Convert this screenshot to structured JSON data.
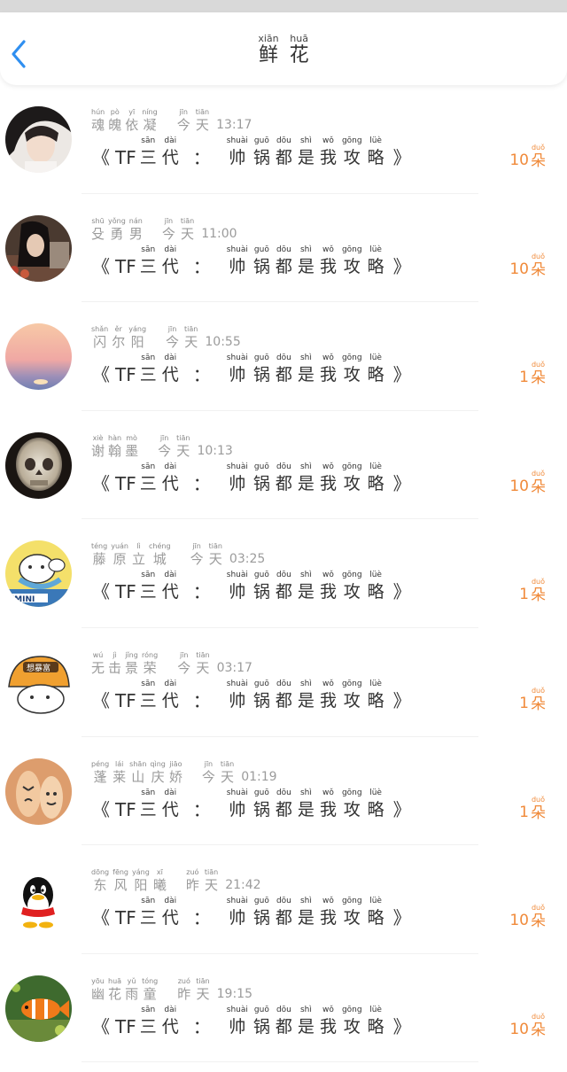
{
  "header": {
    "back_icon": "chevron-left-icon",
    "title": [
      {
        "py": "xiān",
        "hz": "鲜"
      },
      {
        "py": "huā",
        "hz": "花"
      }
    ]
  },
  "colors": {
    "accent": "#2f8ff0",
    "count": "#f08a3a"
  },
  "items": [
    {
      "name": [
        {
          "py": "hún",
          "hz": "魂"
        },
        {
          "py": "pò",
          "hz": "魄"
        },
        {
          "py": "yī",
          "hz": "依"
        },
        {
          "py": "níng",
          "hz": "凝"
        }
      ],
      "date": [
        {
          "py": "jīn",
          "hz": "今"
        },
        {
          "py": "tiān",
          "hz": "天"
        }
      ],
      "time": "13:17",
      "count": "10",
      "unit": {
        "py": "duǒ",
        "hz": "朵"
      }
    },
    {
      "name": [
        {
          "py": "shū",
          "hz": "殳"
        },
        {
          "py": "yǒng",
          "hz": "勇"
        },
        {
          "py": "nán",
          "hz": "男"
        }
      ],
      "date": [
        {
          "py": "jīn",
          "hz": "今"
        },
        {
          "py": "tiān",
          "hz": "天"
        }
      ],
      "time": "11:00",
      "count": "10",
      "unit": {
        "py": "duǒ",
        "hz": "朵"
      }
    },
    {
      "name": [
        {
          "py": "shǎn",
          "hz": "闪"
        },
        {
          "py": "ěr",
          "hz": "尔"
        },
        {
          "py": "yáng",
          "hz": "阳"
        }
      ],
      "date": [
        {
          "py": "jīn",
          "hz": "今"
        },
        {
          "py": "tiān",
          "hz": "天"
        }
      ],
      "time": "10:55",
      "count": "1",
      "unit": {
        "py": "duǒ",
        "hz": "朵"
      }
    },
    {
      "name": [
        {
          "py": "xiè",
          "hz": "谢"
        },
        {
          "py": "hàn",
          "hz": "翰"
        },
        {
          "py": "mò",
          "hz": "墨"
        }
      ],
      "date": [
        {
          "py": "jīn",
          "hz": "今"
        },
        {
          "py": "tiān",
          "hz": "天"
        }
      ],
      "time": "10:13",
      "count": "10",
      "unit": {
        "py": "duǒ",
        "hz": "朵"
      }
    },
    {
      "name": [
        {
          "py": "téng",
          "hz": "藤"
        },
        {
          "py": "yuán",
          "hz": "原"
        },
        {
          "py": "lì",
          "hz": "立"
        },
        {
          "py": "chéng",
          "hz": "城"
        }
      ],
      "date": [
        {
          "py": "jīn",
          "hz": "今"
        },
        {
          "py": "tiān",
          "hz": "天"
        }
      ],
      "time": "03:25",
      "count": "1",
      "unit": {
        "py": "duǒ",
        "hz": "朵"
      }
    },
    {
      "name": [
        {
          "py": "wú",
          "hz": "无"
        },
        {
          "py": "jì",
          "hz": "击"
        },
        {
          "py": "jǐng",
          "hz": "景"
        },
        {
          "py": "róng",
          "hz": "荣"
        }
      ],
      "date": [
        {
          "py": "jīn",
          "hz": "今"
        },
        {
          "py": "tiān",
          "hz": "天"
        }
      ],
      "time": "03:17",
      "count": "1",
      "unit": {
        "py": "duǒ",
        "hz": "朵"
      }
    },
    {
      "name": [
        {
          "py": "péng",
          "hz": "蓬"
        },
        {
          "py": "lái",
          "hz": "莱"
        },
        {
          "py": "shān",
          "hz": "山"
        },
        {
          "py": "qìng",
          "hz": "庆"
        },
        {
          "py": "jiāo",
          "hz": "娇"
        }
      ],
      "date": [
        {
          "py": "jīn",
          "hz": "今"
        },
        {
          "py": "tiān",
          "hz": "天"
        }
      ],
      "time": "01:19",
      "count": "1",
      "unit": {
        "py": "duǒ",
        "hz": "朵"
      }
    },
    {
      "name": [
        {
          "py": "dōng",
          "hz": "东"
        },
        {
          "py": "fēng",
          "hz": "风"
        },
        {
          "py": "yáng",
          "hz": "阳"
        },
        {
          "py": "xī",
          "hz": "曦"
        }
      ],
      "date": [
        {
          "py": "zuó",
          "hz": "昨"
        },
        {
          "py": "tiān",
          "hz": "天"
        }
      ],
      "time": "21:42",
      "count": "10",
      "unit": {
        "py": "duǒ",
        "hz": "朵"
      }
    },
    {
      "name": [
        {
          "py": "yōu",
          "hz": "幽"
        },
        {
          "py": "huā",
          "hz": "花"
        },
        {
          "py": "yǔ",
          "hz": "雨"
        },
        {
          "py": "tóng",
          "hz": "童"
        }
      ],
      "date": [
        {
          "py": "zuó",
          "hz": "昨"
        },
        {
          "py": "tiān",
          "hz": "天"
        }
      ],
      "time": "19:15",
      "count": "10",
      "unit": {
        "py": "duǒ",
        "hz": "朵"
      }
    }
  ],
  "book": {
    "open": "《",
    "prefix": "TF",
    "sandai": [
      {
        "py": "sān",
        "hz": "三"
      },
      {
        "py": "dài",
        "hz": "代"
      }
    ],
    "colon": "：",
    "rest": [
      {
        "py": "shuài",
        "hz": "帅"
      },
      {
        "py": "guō",
        "hz": "锅"
      },
      {
        "py": "dōu",
        "hz": "都"
      },
      {
        "py": "shì",
        "hz": "是"
      },
      {
        "py": "wǒ",
        "hz": "我"
      },
      {
        "py": "gōng",
        "hz": "攻"
      },
      {
        "py": "lüè",
        "hz": "略"
      }
    ],
    "close": "》"
  }
}
